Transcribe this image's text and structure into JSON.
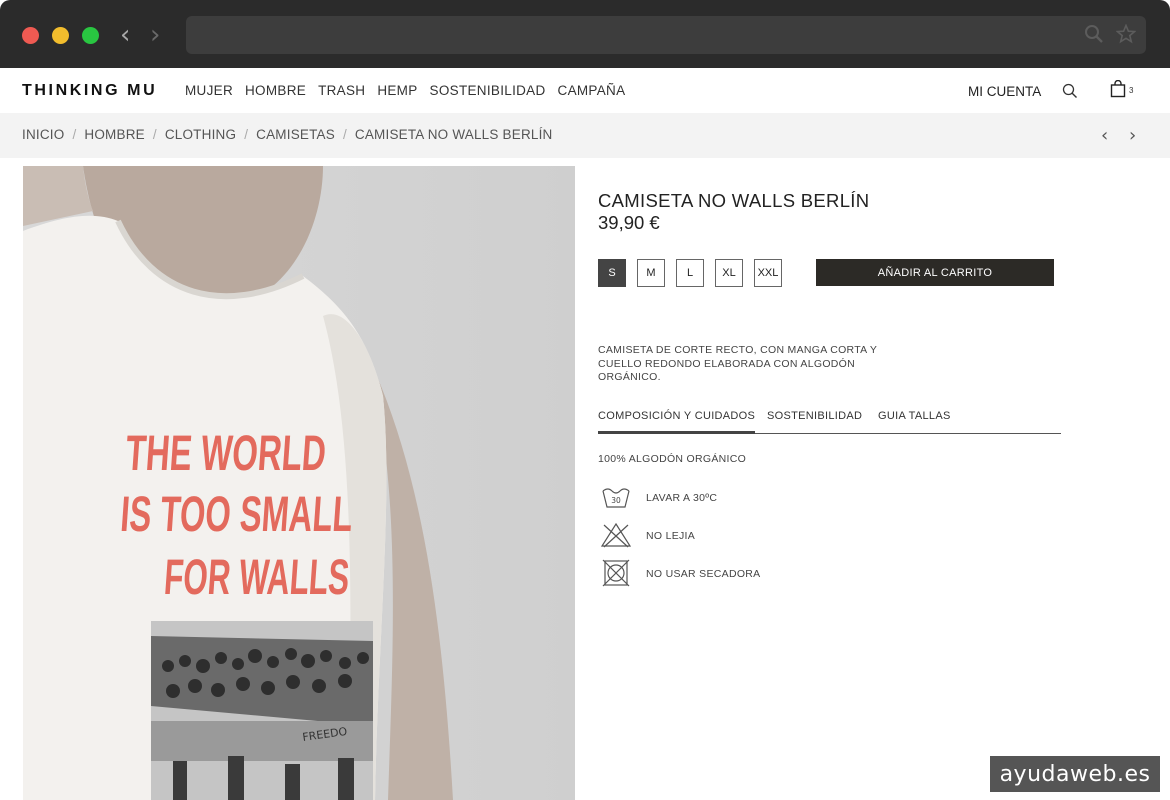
{
  "store": {
    "logo": "THINKING MU",
    "nav": [
      "MUJER",
      "HOMBRE",
      "TRASH",
      "HEMP",
      "SOSTENIBILIDAD",
      "CAMPAÑA"
    ],
    "account_label": "MI CUENTA",
    "cart_count": "3"
  },
  "breadcrumb": [
    "INICIO",
    "HOMBRE",
    "CLOTHING",
    "CAMISETAS",
    "CAMISETA NO WALLS BERLÍN"
  ],
  "product": {
    "title": "CAMISETA NO WALLS BERLÍN",
    "price": "39,90 €",
    "sizes": [
      "S",
      "M",
      "L",
      "XL",
      "XXL"
    ],
    "selected_size": "S",
    "add_to_cart": "AÑADIR AL CARRITO",
    "description": "CAMISETA DE CORTE RECTO, CON MANGA CORTA Y CUELLO REDONDO ELABORADA CON ALGODÓN ORGÁNICO.",
    "image_print": [
      "THE WORLD",
      "IS TOO SMALL",
      "FOR WALLS"
    ],
    "image_graffiti": "FREEDO"
  },
  "tabs": [
    "COMPOSICIÓN Y CUIDADOS",
    "SOSTENIBILIDAD",
    "GUIA TALLAS"
  ],
  "active_tab": "COMPOSICIÓN Y CUIDADOS",
  "composition": "100% ALGODÓN ORGÁNICO",
  "care": [
    {
      "icon": "wash-30-icon",
      "label": "LAVAR A 30ºC",
      "symbol_text": "30"
    },
    {
      "icon": "no-bleach-icon",
      "label": "NO LEJIA"
    },
    {
      "icon": "no-tumble-dry-icon",
      "label": "NO USAR SECADORA"
    }
  ],
  "watermark": "ayudaweb.es",
  "colors": {
    "accent_button": "#2c2a26",
    "print_red": "#e36a5d",
    "chrome": "#2b2b2b"
  }
}
